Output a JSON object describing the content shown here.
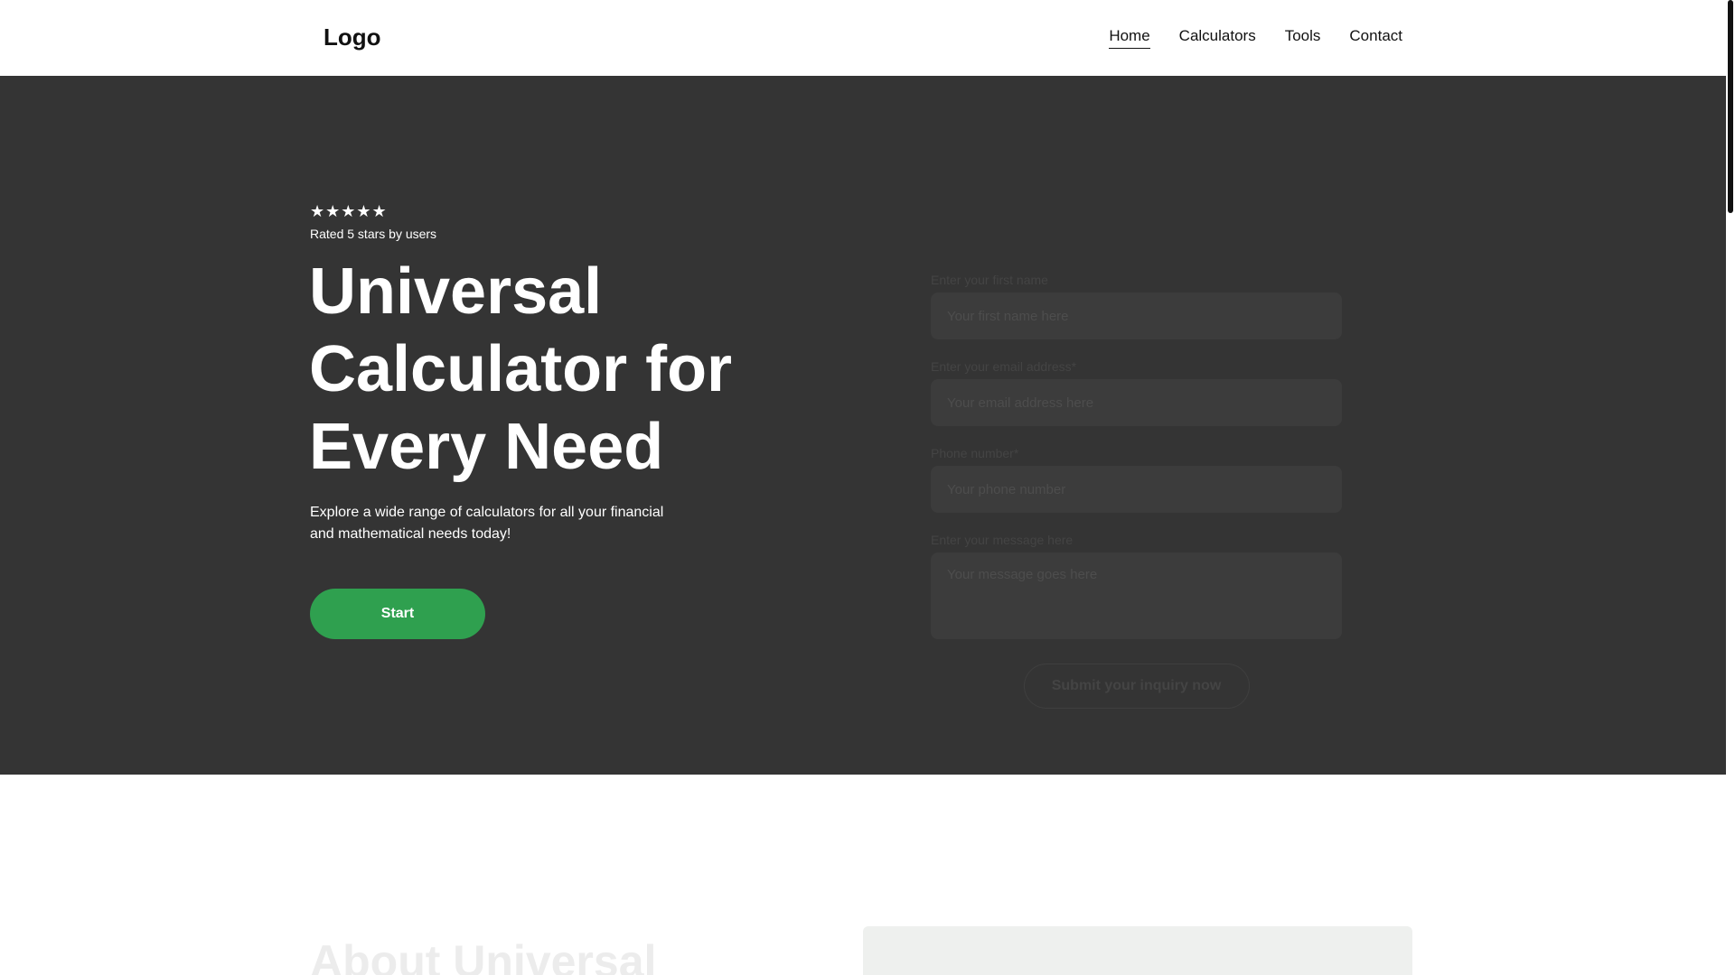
{
  "header": {
    "logo": "Logo",
    "nav": [
      {
        "label": "Home",
        "active": true
      },
      {
        "label": "Calculators",
        "active": false
      },
      {
        "label": "Tools",
        "active": false
      },
      {
        "label": "Contact",
        "active": false
      }
    ]
  },
  "hero": {
    "rating": {
      "stars": "★★★★★",
      "value": 5,
      "max": 5,
      "label": "Rated 5 stars by users"
    },
    "title": "Universal Calculator for Every Need",
    "subtitle": "Explore a wide range of calculators for all your financial and mathematical needs today!",
    "cta_label": "Start"
  },
  "form": {
    "fields": [
      {
        "label": "Enter your first name",
        "placeholder": "Your first name here"
      },
      {
        "label": "Enter your email address*",
        "placeholder": "Your email address here"
      },
      {
        "label": "Phone number*",
        "placeholder": "Your phone number"
      },
      {
        "label": "Enter your message here",
        "placeholder": "Your message goes here"
      }
    ],
    "submit_label": "Submit your inquiry now"
  },
  "about": {
    "title": "About Universal"
  },
  "colors": {
    "hero_bg": "#343434",
    "accent": "#2fa04f"
  }
}
